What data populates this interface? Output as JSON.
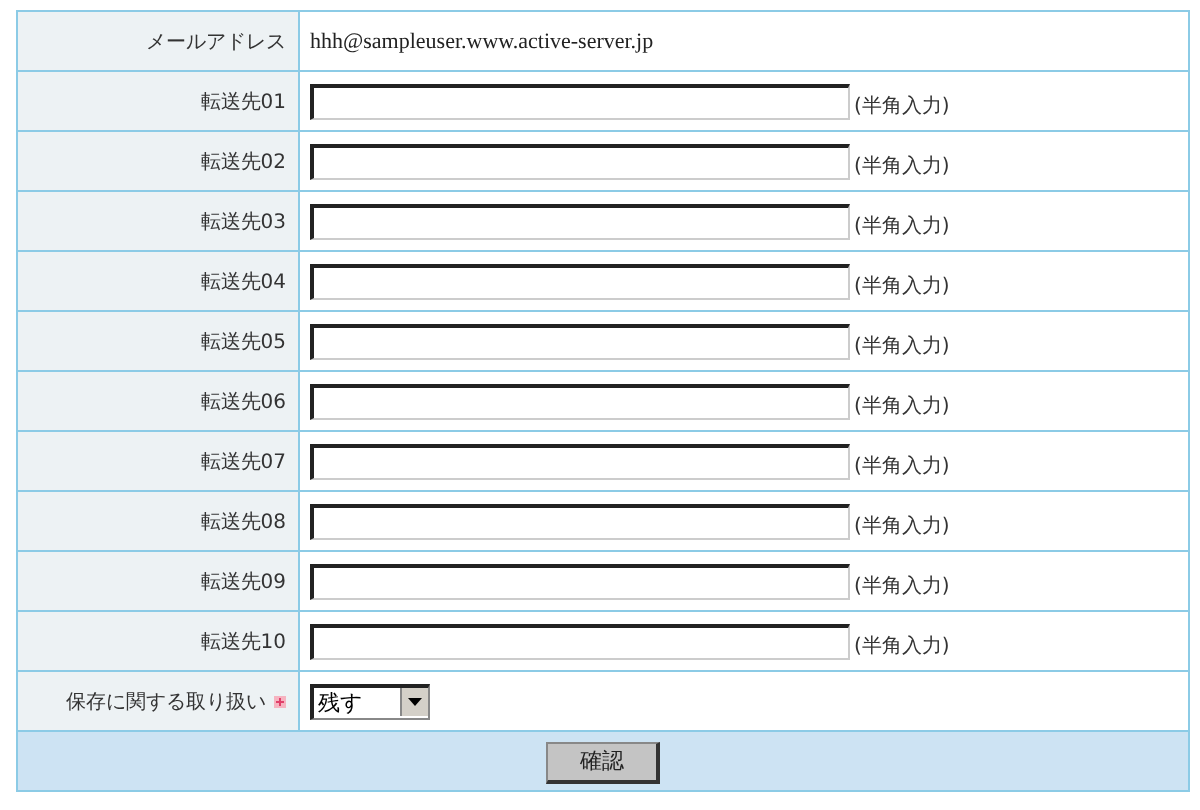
{
  "email_row": {
    "label": "メールアドレス",
    "value": "hhh@sampleuser.www.active-server.jp"
  },
  "forward_rows": [
    {
      "label": "転送先01",
      "hint": "(半角入力)"
    },
    {
      "label": "転送先02",
      "hint": "(半角入力)"
    },
    {
      "label": "転送先03",
      "hint": "(半角入力)"
    },
    {
      "label": "転送先04",
      "hint": "(半角入力)"
    },
    {
      "label": "転送先05",
      "hint": "(半角入力)"
    },
    {
      "label": "転送先06",
      "hint": "(半角入力)"
    },
    {
      "label": "転送先07",
      "hint": "(半角入力)"
    },
    {
      "label": "転送先08",
      "hint": "(半角入力)"
    },
    {
      "label": "転送先09",
      "hint": "(半角入力)"
    },
    {
      "label": "転送先10",
      "hint": "(半角入力)"
    }
  ],
  "storage_row": {
    "label": "保存に関する取り扱い",
    "required": true,
    "value": "残す"
  },
  "confirm_button": "確認"
}
